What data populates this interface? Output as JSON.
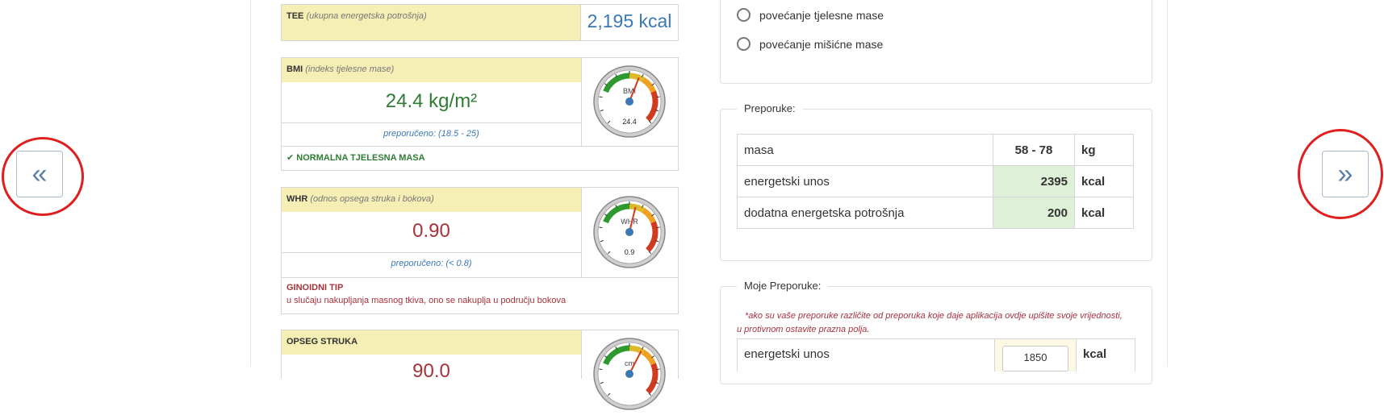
{
  "nav": {
    "prev_label": "«",
    "next_label": "»"
  },
  "tee": {
    "label": "TEE",
    "sublabel": "(ukupna energetska potrošnja)",
    "value": "2,195 kcal"
  },
  "bmi": {
    "label": "BMI",
    "sublabel": "(indeks tjelesne mase)",
    "value": "24.4 kg/m²",
    "recommended": "preporučeno: (18.5 - 25)",
    "status": "NORMALNA TJELESNA MASA",
    "gauge": {
      "label": "BMI",
      "reading": "24.4",
      "fraction": 0.58
    }
  },
  "whr": {
    "label": "WHR",
    "sublabel": "(odnos opsega struka i bokova)",
    "value": "0.90",
    "recommended": "preporučeno: (< 0.8)",
    "type_title": "GINOIDNI TIP",
    "type_desc": "u slučaju nakupljanja masnog tkiva, ono se nakuplja u području bokova",
    "gauge": {
      "label": "WHR",
      "reading": "0.9",
      "fraction": 0.55
    }
  },
  "waist": {
    "label": "OPSEG STRUKA",
    "value": "90.0",
    "gauge": {
      "label": "cm",
      "reading": "",
      "fraction": 0.6
    }
  },
  "goals": {
    "options": [
      "povećanje tjelesne mase",
      "povećanje mišićne mase"
    ]
  },
  "recommendations": {
    "title": "Preporuke:",
    "rows": [
      {
        "label": "masa",
        "value": "58 - 78",
        "unit": "kg"
      },
      {
        "label": "energetski unos",
        "value": "2395",
        "unit": "kcal"
      },
      {
        "label": "dodatna energetska potrošnja",
        "value": "200",
        "unit": "kcal"
      }
    ]
  },
  "my_recommendations": {
    "title": "Moje Preporuke:",
    "note_line1": "*ako su vaše preporuke različite od preporuka koje daje aplikacija ovdje upišite svoje vrijednosti,",
    "note_line2": "u protivnom ostavite prazna polja.",
    "row": {
      "label": "energetski unos",
      "value": "1850",
      "unit": "kcal"
    }
  },
  "colors": {
    "accent_blue": "#3a78b6",
    "green": "#2e7d32",
    "red": "#a8323a",
    "yellow": "#f6efb5",
    "highlight": "#dff0d8"
  }
}
